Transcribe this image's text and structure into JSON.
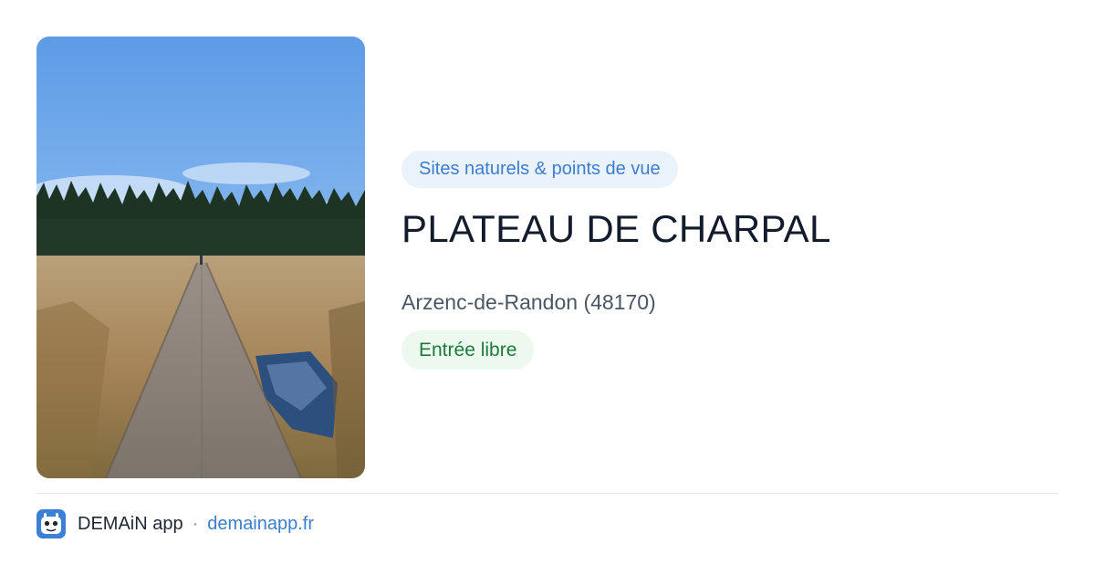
{
  "card": {
    "category": "Sites naturels & points de vue",
    "title": "PLATEAU DE CHARPAL",
    "location": "Arzenc-de-Randon (48170)",
    "access": "Entrée libre"
  },
  "footer": {
    "app_name": "DEMAiN app",
    "separator": "·",
    "link": "demainapp.fr"
  },
  "colors": {
    "category_text": "#3c7dd0",
    "category_bg": "#eaf2fc",
    "access_text": "#1e7a3a",
    "access_bg": "#edf8ef",
    "title": "#131c2c",
    "link": "#3c7dd0",
    "app_icon": "#3b7fd6"
  },
  "icons": {
    "app_icon": "demain-app-icon"
  }
}
